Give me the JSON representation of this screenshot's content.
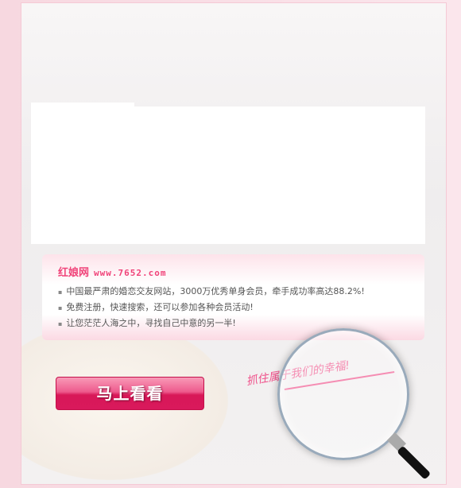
{
  "brand": {
    "name": "红娘网",
    "url": "www.7652.com"
  },
  "features": [
    "中国最严肃的婚恋交友网站，3000万优秀单身会员，牵手成功率高达88.2%!",
    "免费注册，快速搜索，还可以参加各种会员活动!",
    "让您茫茫人海之中，寻找自己中意的另一半!"
  ],
  "cta": {
    "label": "马上看看"
  },
  "slogan": "抓住属于我们的幸福!",
  "colors": {
    "accent": "#f0447a",
    "button": "#d9195c"
  }
}
